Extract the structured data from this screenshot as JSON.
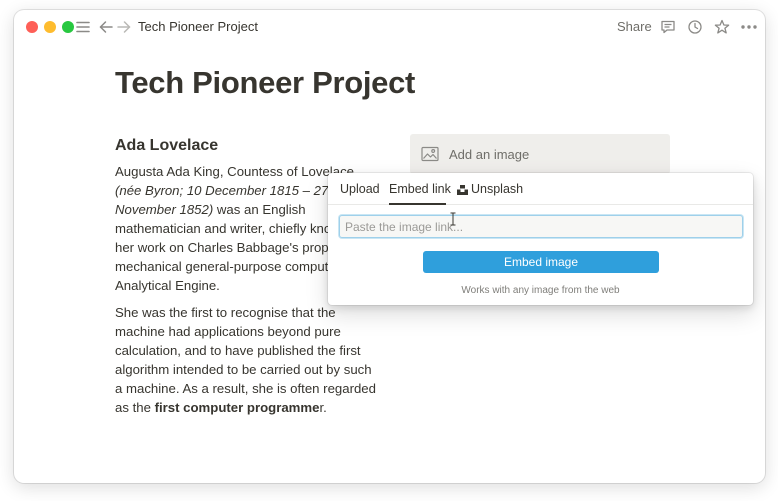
{
  "titlebar": {
    "breadcrumb": "Tech Pioneer Project",
    "share_label": "Share",
    "icons": [
      "hamburger-icon",
      "back-arrow-icon",
      "forward-arrow-icon",
      "comment-icon",
      "clock-icon",
      "star-icon",
      "more-icon"
    ]
  },
  "page": {
    "title": "Tech Pioneer Project",
    "heading": "Ada Lovelace",
    "para1": {
      "text1": "Augusta Ada King, Countess of Lovelace ",
      "italic": "(née Byron; 10 December 1815 – 27 November 1852)",
      "text2": " was an English mathematician and writer, chiefly known for her work on Charles Babbage's proposed mechanical general-purpose computer, the Analytical Engine."
    },
    "para2": {
      "text1": "She was the first to recognise that the machine had applications beyond pure calculation, and to have published the first algorithm intended to be carried out by such a machine. As a result, she is often regarded as the ",
      "bold": "first computer programme",
      "text2": "r."
    }
  },
  "image_block": {
    "label": "Add an image",
    "icon": "image-icon"
  },
  "popover": {
    "tabs": [
      {
        "label": "Upload",
        "active": false
      },
      {
        "label": "Embed link",
        "active": true
      },
      {
        "label": "Unsplash",
        "active": false
      }
    ],
    "input_value": "",
    "input_placeholder": "Paste the image link...",
    "button_label": "Embed image",
    "hint": "Works with any image from the web"
  },
  "colors": {
    "text": "#37352f",
    "accent": "#2f9fdc",
    "block_bg": "#efeeeb"
  }
}
